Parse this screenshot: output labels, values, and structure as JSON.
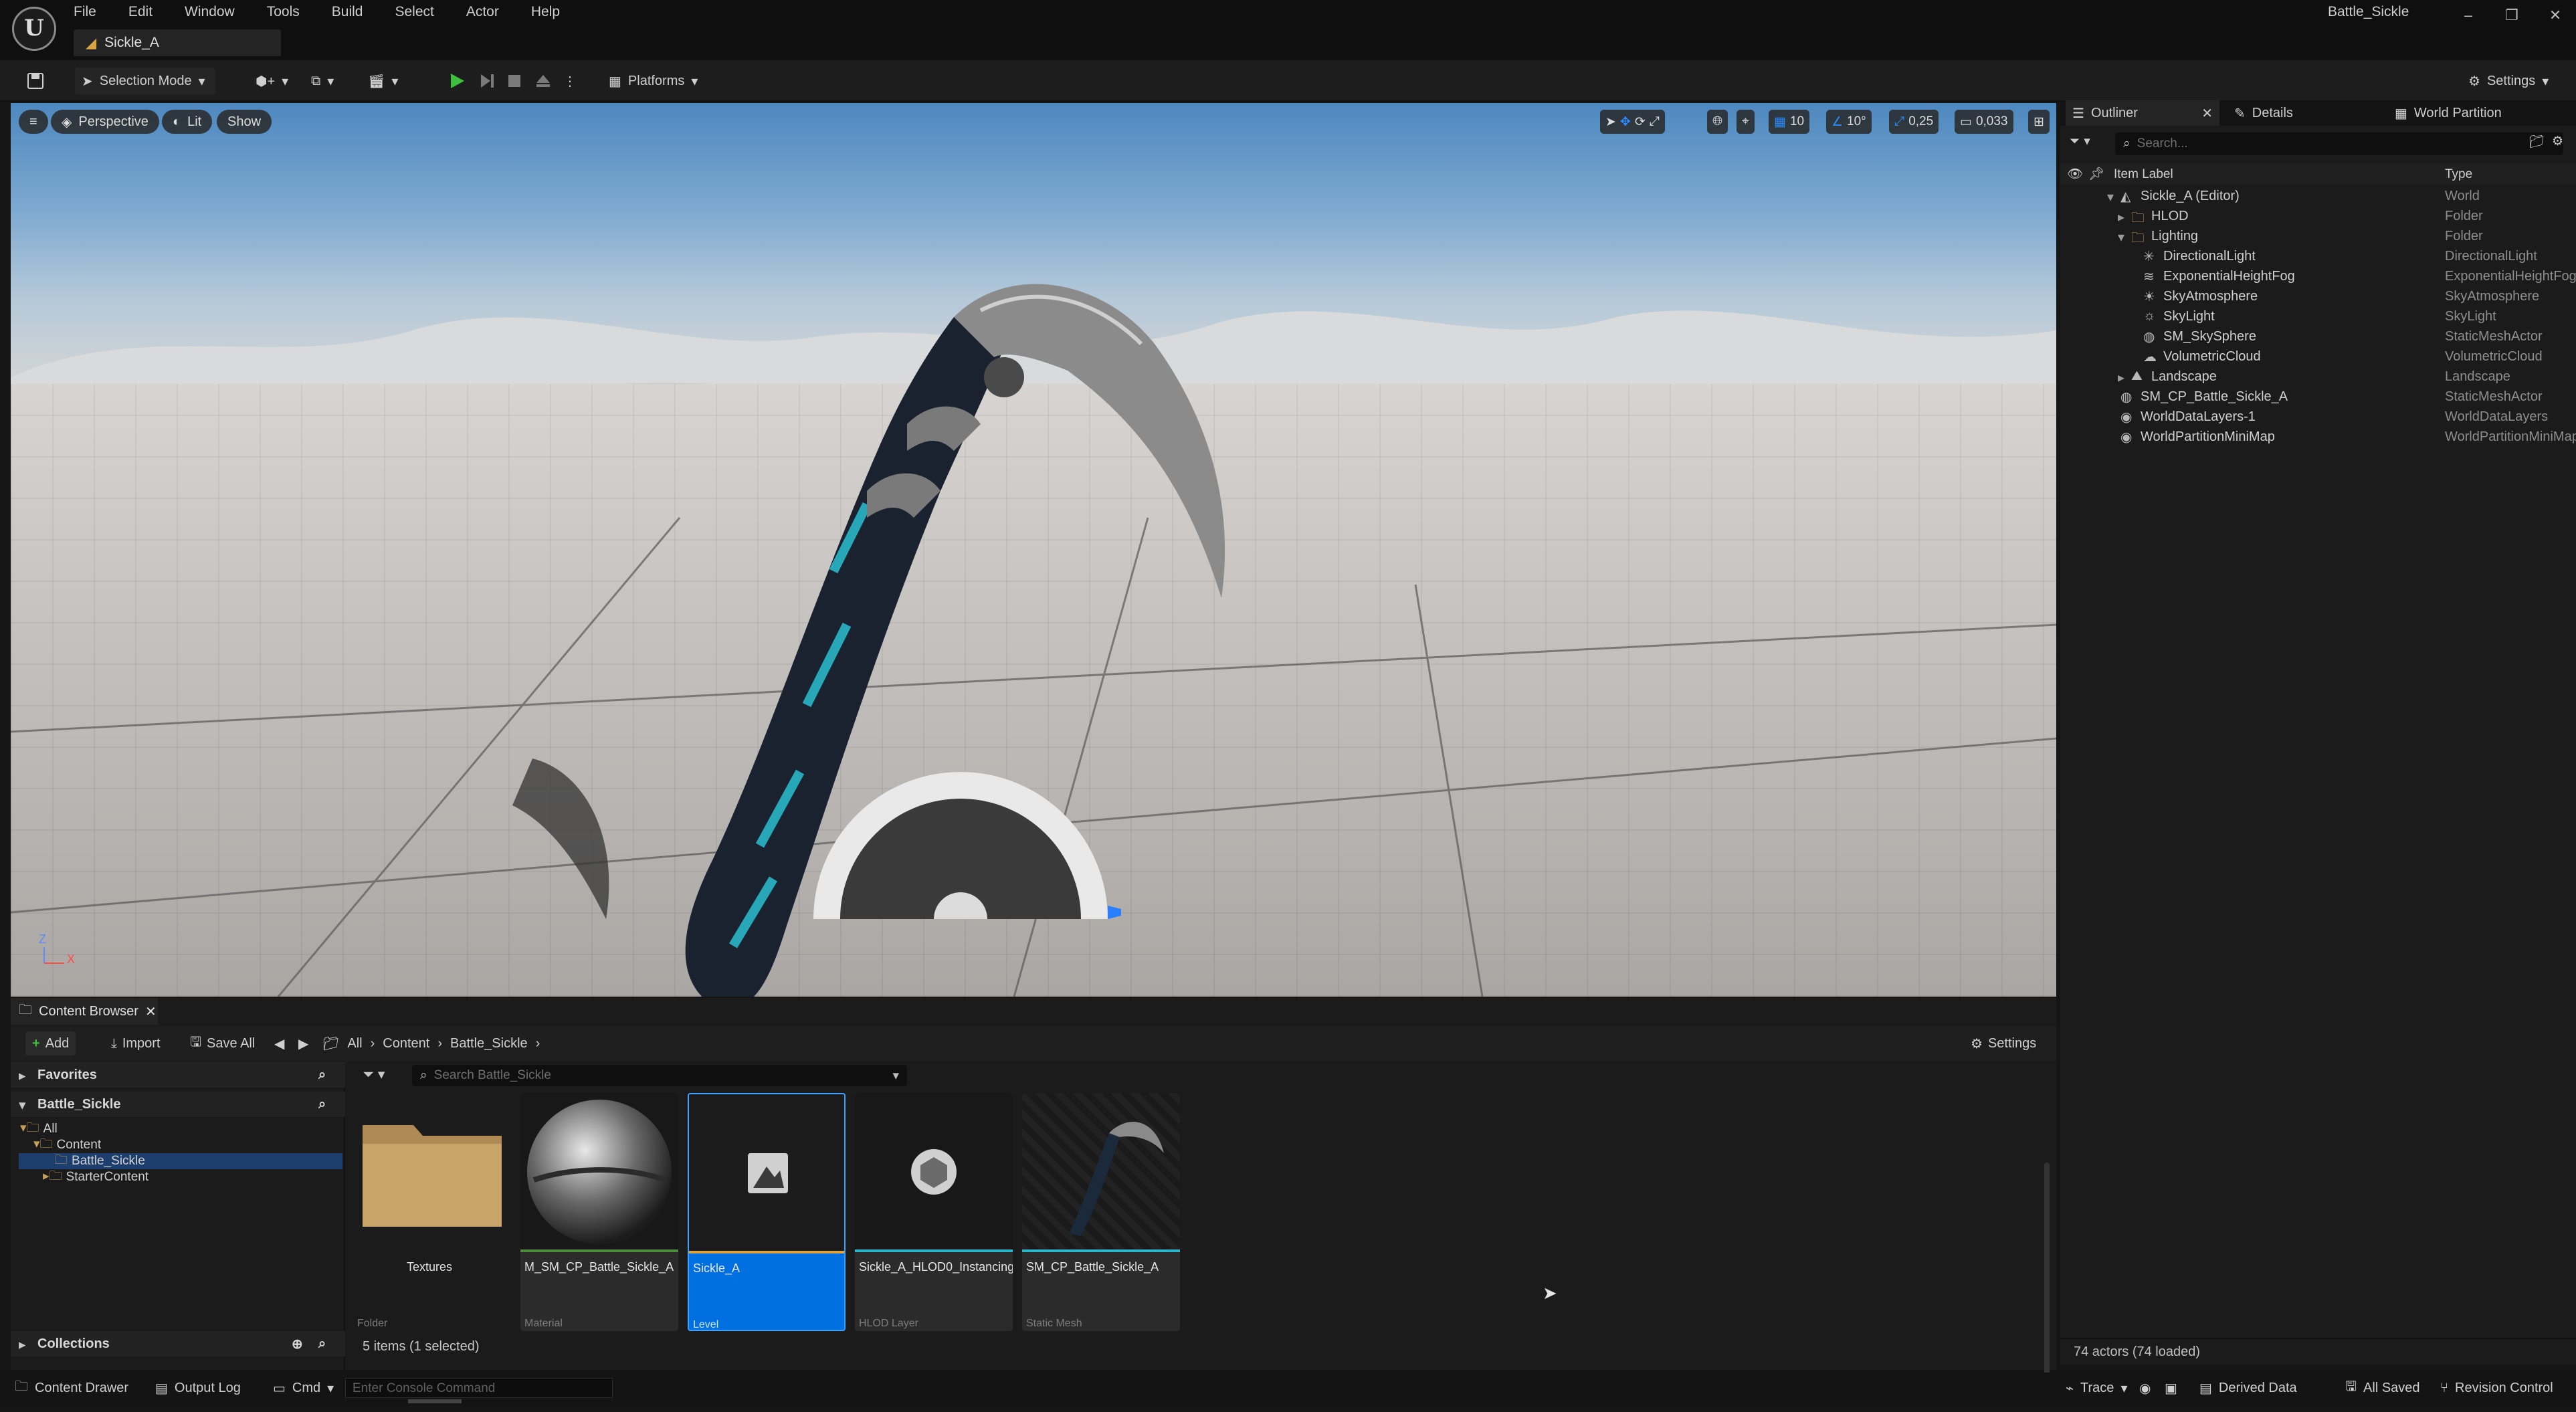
{
  "titlebar": {
    "menu": [
      "File",
      "Edit",
      "Window",
      "Tools",
      "Build",
      "Select",
      "Actor",
      "Help"
    ],
    "doc_tab": "Sickle_A",
    "project": "Battle_Sickle"
  },
  "toolbar": {
    "selection_mode": "Selection Mode",
    "platforms": "Platforms",
    "settings": "Settings"
  },
  "viewport": {
    "perspective": "Perspective",
    "lit": "Lit",
    "show": "Show",
    "grid_snap": "10",
    "rot_snap": "10°",
    "scale_snap": "0,25",
    "camera_speed": "0,033",
    "axis_z": "Z",
    "axis_x": "X"
  },
  "outliner": {
    "tabs": [
      "Outliner",
      "Details",
      "World Partition"
    ],
    "search_placeholder": "Search...",
    "col_label": "Item Label",
    "col_type": "Type",
    "rows": [
      {
        "label": "Sickle_A (Editor)",
        "type": "World"
      },
      {
        "label": "HLOD",
        "type": "Folder"
      },
      {
        "label": "Lighting",
        "type": "Folder"
      },
      {
        "label": "DirectionalLight",
        "type": "DirectionalLight"
      },
      {
        "label": "ExponentialHeightFog",
        "type": "ExponentialHeightFog"
      },
      {
        "label": "SkyAtmosphere",
        "type": "SkyAtmosphere"
      },
      {
        "label": "SkyLight",
        "type": "SkyLight"
      },
      {
        "label": "SM_SkySphere",
        "type": "StaticMeshActor"
      },
      {
        "label": "VolumetricCloud",
        "type": "VolumetricCloud"
      },
      {
        "label": "Landscape",
        "type": "Landscape"
      },
      {
        "label": "SM_CP_Battle_Sickle_A",
        "type": "StaticMeshActor"
      },
      {
        "label": "WorldDataLayers-1",
        "type": "WorldDataLayers"
      },
      {
        "label": "WorldPartitionMiniMap",
        "type": "WorldPartitionMiniMap"
      }
    ],
    "footer": "74 actors (74 loaded)"
  },
  "content_browser": {
    "tab": "Content Browser",
    "add": "Add",
    "import": "Import",
    "save_all": "Save All",
    "breadcrumb": [
      "All",
      "Content",
      "Battle_Sickle"
    ],
    "settings": "Settings",
    "favorites": "Favorites",
    "root": "Battle_Sickle",
    "tree": [
      "All",
      "Content",
      "Battle_Sickle",
      "StarterContent"
    ],
    "collections": "Collections",
    "search_placeholder": "Search Battle_Sickle",
    "assets": [
      {
        "name": "Textures",
        "kind": "Folder"
      },
      {
        "name": "M_SM_CP_Battle_Sickle_A",
        "kind": "Material"
      },
      {
        "name": "Sickle_A",
        "kind": "Level"
      },
      {
        "name": "Sickle_A_HLOD0_Instancing",
        "kind": "HLOD Layer"
      },
      {
        "name": "SM_CP_Battle_Sickle_A",
        "kind": "Static Mesh"
      }
    ],
    "status": "5 items (1 selected)"
  },
  "bottombar": {
    "content_drawer": "Content Drawer",
    "output_log": "Output Log",
    "cmd": "Cmd",
    "console_placeholder": "Enter Console Command",
    "trace": "Trace",
    "derived_data": "Derived Data",
    "all_saved": "All Saved",
    "revision_control": "Revision Control"
  },
  "colors": {
    "selection_blue": "#0070e0",
    "play_green": "#3fbf3f",
    "accent_cyan": "#2ab6c8"
  }
}
